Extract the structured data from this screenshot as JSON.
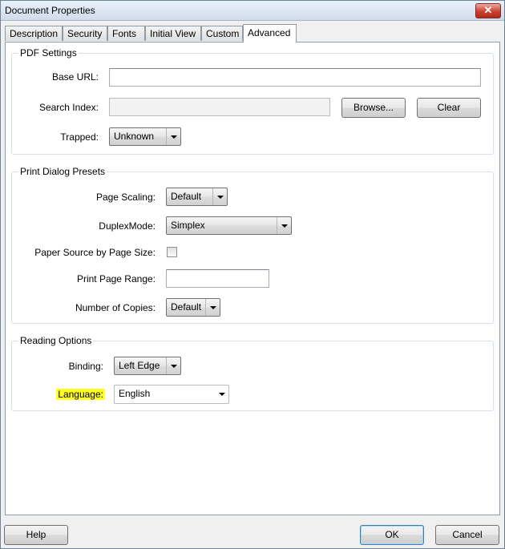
{
  "window": {
    "title": "Document Properties",
    "close_glyph": "✕"
  },
  "tabs": [
    "Description",
    "Security",
    "Fonts",
    "Initial View",
    "Custom",
    "Advanced"
  ],
  "active_tab": "Advanced",
  "pdf_settings": {
    "title": "PDF Settings",
    "base_url_label": "Base URL:",
    "base_url_value": "",
    "search_index_label": "Search Index:",
    "search_index_value": "",
    "browse_label": "Browse...",
    "clear_label": "Clear",
    "trapped_label": "Trapped:",
    "trapped_value": "Unknown"
  },
  "print_presets": {
    "title": "Print Dialog Presets",
    "page_scaling_label": "Page Scaling:",
    "page_scaling_value": "Default",
    "duplex_label": "DuplexMode:",
    "duplex_value": "Simplex",
    "paper_source_label": "Paper Source by Page Size:",
    "paper_source_checked": false,
    "page_range_label": "Print Page Range:",
    "page_range_value": "",
    "copies_label": "Number of Copies:",
    "copies_value": "Default"
  },
  "reading_options": {
    "title": "Reading Options",
    "binding_label": "Binding:",
    "binding_value": "Left Edge",
    "language_label": "Language:",
    "language_value": "English"
  },
  "footer": {
    "help_label": "Help",
    "ok_label": "OK",
    "cancel_label": "Cancel"
  },
  "colors": {
    "highlight": "#ffff22",
    "close_button": "#c9422f"
  }
}
